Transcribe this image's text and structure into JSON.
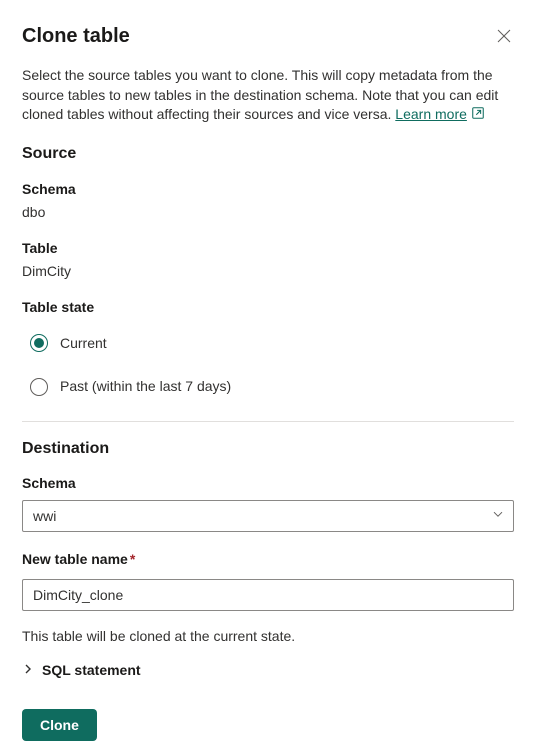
{
  "header": {
    "title": "Clone table"
  },
  "description": {
    "text": "Select the source tables you want to clone. This will copy metadata from the source tables to new tables in the destination schema. Note that you can edit cloned tables without affecting their sources and vice versa. ",
    "learn_more": "Learn more"
  },
  "source": {
    "heading": "Source",
    "schema_label": "Schema",
    "schema_value": "dbo",
    "table_label": "Table",
    "table_value": "DimCity",
    "state_label": "Table state",
    "radio_current": "Current",
    "radio_past": "Past (within the last 7 days)"
  },
  "destination": {
    "heading": "Destination",
    "schema_label": "Schema",
    "schema_value": "wwi",
    "new_table_label": "New table name",
    "new_table_value": "DimCity_clone"
  },
  "info_text": "This table will be cloned at the current state.",
  "sql_statement_label": "SQL statement",
  "clone_button": "Clone"
}
